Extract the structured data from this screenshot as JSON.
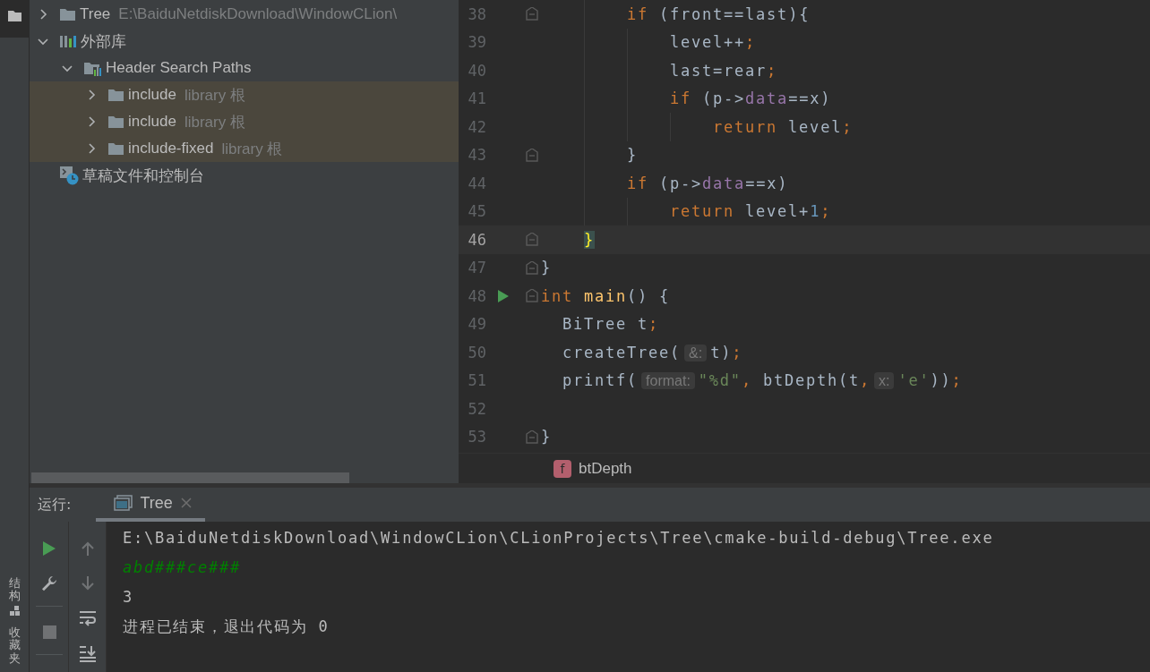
{
  "left_toolbar": {
    "buttons": [
      {
        "kind": "project",
        "selected": true
      },
      {
        "kind": "structure",
        "label": "结构",
        "selected": false
      },
      {
        "kind": "favorites",
        "label": "收藏夹",
        "selected": false
      }
    ]
  },
  "project_tree": {
    "items": [
      {
        "kind": "folder",
        "label": "Tree",
        "hint": "E:\\BaiduNetdiskDownload\\WindowCLion\\",
        "expanded": false,
        "highlighted": false
      },
      {
        "kind": "library",
        "label": "外部库",
        "expanded": true,
        "highlighted": false,
        "children": [
          {
            "kind": "header-paths",
            "label": "Header Search Paths",
            "expanded": true,
            "highlighted": false,
            "children": [
              {
                "kind": "folder",
                "label": "include",
                "hint": "library 根",
                "expanded": false,
                "highlighted": true
              },
              {
                "kind": "folder",
                "label": "include",
                "hint": "library 根",
                "expanded": false,
                "highlighted": true
              },
              {
                "kind": "folder",
                "label": "include-fixed",
                "hint": "library 根",
                "expanded": false,
                "highlighted": true
              }
            ]
          }
        ]
      },
      {
        "kind": "scratches",
        "label": "草稿文件和控制台",
        "highlighted": false
      }
    ]
  },
  "editor": {
    "lines": [
      {
        "number": "38",
        "fold": true,
        "tokens": [
          {
            "kind": "keyword",
            "text": "        if"
          },
          {
            "kind": "plain",
            "text": " (front==last){"
          }
        ]
      },
      {
        "number": "39",
        "tokens": [
          {
            "kind": "plain",
            "text": "            level++"
          },
          {
            "kind": "keyword",
            "text": ";"
          }
        ]
      },
      {
        "number": "40",
        "tokens": [
          {
            "kind": "plain",
            "text": "            last=rear"
          },
          {
            "kind": "keyword",
            "text": ";"
          }
        ]
      },
      {
        "number": "41",
        "tokens": [
          {
            "kind": "keyword",
            "text": "            if"
          },
          {
            "kind": "plain",
            "text": " (p->"
          },
          {
            "kind": "field",
            "text": "data"
          },
          {
            "kind": "plain",
            "text": "==x)"
          }
        ]
      },
      {
        "number": "42",
        "tokens": [
          {
            "kind": "keyword",
            "text": "                return"
          },
          {
            "kind": "plain",
            "text": " level"
          },
          {
            "kind": "keyword",
            "text": ";"
          }
        ]
      },
      {
        "number": "43",
        "fold": true,
        "tokens": [
          {
            "kind": "plain",
            "text": "        }"
          }
        ]
      },
      {
        "number": "44",
        "tokens": [
          {
            "kind": "keyword",
            "text": "        if"
          },
          {
            "kind": "plain",
            "text": " (p->"
          },
          {
            "kind": "field",
            "text": "data"
          },
          {
            "kind": "plain",
            "text": "==x)"
          }
        ]
      },
      {
        "number": "45",
        "tokens": [
          {
            "kind": "keyword",
            "text": "            return"
          },
          {
            "kind": "plain",
            "text": " level+"
          },
          {
            "kind": "number",
            "text": "1"
          },
          {
            "kind": "keyword",
            "text": ";"
          }
        ]
      },
      {
        "number": "46",
        "fold": true,
        "current": true,
        "tokens": [
          {
            "kind": "brace-match",
            "text": "    }"
          }
        ]
      },
      {
        "number": "47",
        "fold": true,
        "tokens": [
          {
            "kind": "plain",
            "text": "}"
          }
        ]
      },
      {
        "number": "48",
        "fold": true,
        "run": true,
        "tokens": [
          {
            "kind": "keyword",
            "text": "int"
          },
          {
            "kind": "function",
            "text": " main"
          },
          {
            "kind": "plain",
            "text": "() {"
          }
        ]
      },
      {
        "number": "49",
        "tokens": [
          {
            "kind": "plain",
            "text": "  BiTree t"
          },
          {
            "kind": "keyword",
            "text": ";"
          }
        ]
      },
      {
        "number": "50",
        "tokens": [
          {
            "kind": "plain",
            "text": "  createTree("
          },
          {
            "kind": "hint",
            "text": "&:"
          },
          {
            "kind": "plain",
            "text": "t)"
          },
          {
            "kind": "keyword",
            "text": ";"
          }
        ]
      },
      {
        "number": "51",
        "tokens": [
          {
            "kind": "plain",
            "text": "  printf("
          },
          {
            "kind": "hint",
            "text": "format:"
          },
          {
            "kind": "string",
            "text": "\"%d\""
          },
          {
            "kind": "keyword",
            "text": ","
          },
          {
            "kind": "plain",
            "text": " btDepth(t"
          },
          {
            "kind": "keyword",
            "text": ","
          },
          {
            "kind": "hint",
            "text": "x:"
          },
          {
            "kind": "string",
            "text": "'e'"
          },
          {
            "kind": "plain",
            "text": "))"
          },
          {
            "kind": "keyword",
            "text": ";"
          }
        ]
      },
      {
        "number": "52"
      },
      {
        "number": "53",
        "fold": true,
        "tokens": [
          {
            "kind": "plain",
            "text": "}"
          }
        ]
      }
    ],
    "breadcrumb": {
      "badge": "f",
      "label": "btDepth"
    }
  },
  "run_panel": {
    "title": "运行:",
    "tabs": [
      {
        "label": "Tree",
        "selected": true
      }
    ],
    "actions": [
      {
        "kind": "rerun",
        "disabled": false
      },
      {
        "kind": "settings",
        "disabled": false
      },
      {
        "kind": "separator"
      },
      {
        "kind": "stop",
        "disabled": true
      },
      {
        "kind": "separator"
      }
    ],
    "console_actions": [
      {
        "kind": "up",
        "disabled": true
      },
      {
        "kind": "down",
        "disabled": true
      },
      {
        "kind": "wrap",
        "disabled": false
      },
      {
        "kind": "scroll-end",
        "disabled": false
      }
    ],
    "console": [
      {
        "kind": "system",
        "text": "E:\\BaiduNetdiskDownload\\WindowCLion\\CLionProjects\\Tree\\cmake-build-debug\\Tree.exe"
      },
      {
        "kind": "input",
        "text": "abd###ce###"
      },
      {
        "kind": "output",
        "text": "3"
      },
      {
        "kind": "system",
        "text": "进程已结束，退出代码为 0"
      }
    ]
  }
}
